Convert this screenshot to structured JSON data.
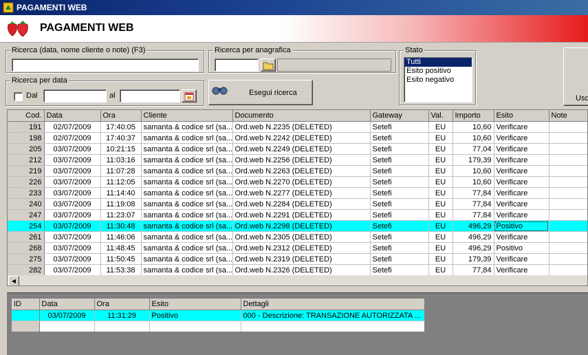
{
  "window": {
    "title": "PAGAMENTI WEB"
  },
  "banner": {
    "title": "PAGAMENTI WEB"
  },
  "search": {
    "text_label": "Ricerca (data, nome cliente o note) (F3)",
    "text_value": "",
    "anagrafica_label": "Ricerca per anagrafica",
    "anagrafica_code": "",
    "anagrafica_name": "",
    "date_label": "Ricerca per data",
    "dal_label": "Dal",
    "dal_value": "",
    "al_label": "al",
    "al_value": "",
    "run_button": "Esegui ricerca"
  },
  "stato": {
    "label": "Stato",
    "options": [
      "Tutti",
      "Esito positivo",
      "Esito negativo"
    ],
    "selected": "Tutti"
  },
  "exit_button": "Usc",
  "payments": {
    "columns": [
      "Cod.",
      "Data",
      "Ora",
      "Cliente",
      "Documento",
      "Gateway",
      "Val.",
      "Importo",
      "Esito",
      "Note"
    ],
    "rows": [
      {
        "cod": "191",
        "data": "02/07/2009",
        "ora": "17:40:05",
        "cliente": "samanta & codice srl (sa...",
        "documento": "Ord.web N.2235 (DELETED)",
        "gateway": "Setefi",
        "val": "EU",
        "importo": "10,60",
        "esito": "Verificare",
        "note": ""
      },
      {
        "cod": "198",
        "data": "02/07/2009",
        "ora": "17:40:37",
        "cliente": "samanta & codice srl (sa...",
        "documento": "Ord.web N.2242 (DELETED)",
        "gateway": "Setefi",
        "val": "EU",
        "importo": "10,60",
        "esito": "Verificare",
        "note": ""
      },
      {
        "cod": "205",
        "data": "03/07/2009",
        "ora": "10:21:15",
        "cliente": "samanta & codice srl (sa...",
        "documento": "Ord.web N.2249 (DELETED)",
        "gateway": "Setefi",
        "val": "EU",
        "importo": "77,04",
        "esito": "Verificare",
        "note": ""
      },
      {
        "cod": "212",
        "data": "03/07/2009",
        "ora": "11:03:16",
        "cliente": "samanta & codice srl (sa...",
        "documento": "Ord.web N.2256 (DELETED)",
        "gateway": "Setefi",
        "val": "EU",
        "importo": "179,39",
        "esito": "Verificare",
        "note": ""
      },
      {
        "cod": "219",
        "data": "03/07/2009",
        "ora": "11:07:28",
        "cliente": "samanta & codice srl (sa...",
        "documento": "Ord.web N.2263 (DELETED)",
        "gateway": "Setefi",
        "val": "EU",
        "importo": "10,60",
        "esito": "Verificare",
        "note": ""
      },
      {
        "cod": "226",
        "data": "03/07/2009",
        "ora": "11:12:05",
        "cliente": "samanta & codice srl (sa...",
        "documento": "Ord.web N.2270 (DELETED)",
        "gateway": "Setefi",
        "val": "EU",
        "importo": "10,60",
        "esito": "Verificare",
        "note": ""
      },
      {
        "cod": "233",
        "data": "03/07/2009",
        "ora": "11:14:40",
        "cliente": "samanta & codice srl (sa...",
        "documento": "Ord.web N.2277 (DELETED)",
        "gateway": "Setefi",
        "val": "EU",
        "importo": "77,84",
        "esito": "Verificare",
        "note": ""
      },
      {
        "cod": "240",
        "data": "03/07/2009",
        "ora": "11:19:08",
        "cliente": "samanta & codice srl (sa...",
        "documento": "Ord.web N.2284 (DELETED)",
        "gateway": "Setefi",
        "val": "EU",
        "importo": "77,84",
        "esito": "Verificare",
        "note": ""
      },
      {
        "cod": "247",
        "data": "03/07/2009",
        "ora": "11:23:07",
        "cliente": "samanta & codice srl (sa...",
        "documento": "Ord.web N.2291 (DELETED)",
        "gateway": "Setefi",
        "val": "EU",
        "importo": "77,84",
        "esito": "Verificare",
        "note": ""
      },
      {
        "cod": "254",
        "data": "03/07/2009",
        "ora": "11:30:48",
        "cliente": "samanta & codice srl (sa...",
        "documento": "Ord.web N.2298 (DELETED)",
        "gateway": "Setefi",
        "val": "EU",
        "importo": "496,29",
        "esito": "Positivo",
        "note": "",
        "selected": true
      },
      {
        "cod": "261",
        "data": "03/07/2009",
        "ora": "11:46:06",
        "cliente": "samanta & codice srl (sa...",
        "documento": "Ord.web N.2305 (DELETED)",
        "gateway": "Setefi",
        "val": "EU",
        "importo": "496,29",
        "esito": "Verificare",
        "note": ""
      },
      {
        "cod": "268",
        "data": "03/07/2009",
        "ora": "11:48:45",
        "cliente": "samanta & codice srl (sa...",
        "documento": "Ord.web N.2312 (DELETED)",
        "gateway": "Setefi",
        "val": "EU",
        "importo": "496,29",
        "esito": "Positivo",
        "note": ""
      },
      {
        "cod": "275",
        "data": "03/07/2009",
        "ora": "11:50:45",
        "cliente": "samanta & codice srl (sa...",
        "documento": "Ord.web N.2319 (DELETED)",
        "gateway": "Setefi",
        "val": "EU",
        "importo": "179,39",
        "esito": "Verificare",
        "note": ""
      },
      {
        "cod": "282",
        "data": "03/07/2009",
        "ora": "11:53:38",
        "cliente": "samanta & codice srl (sa...",
        "documento": "Ord.web N.2326 (DELETED)",
        "gateway": "Setefi",
        "val": "EU",
        "importo": "77,84",
        "esito": "Verificare",
        "note": ""
      }
    ]
  },
  "details": {
    "columns": [
      "ID",
      "Data",
      "Ora",
      "Esito",
      "Dettagli"
    ],
    "rows": [
      {
        "id": "",
        "data": "03/07/2009",
        "ora": "11:31:29",
        "esito": "Positivo",
        "dettagli": "000 - Descrizione: TRANSAZIONE AUTORIZZATA ...",
        "selected": true
      },
      {
        "id": "",
        "data": "",
        "ora": "",
        "esito": "",
        "dettagli": ""
      }
    ]
  },
  "colors": {
    "selection": "#00ffff",
    "face": "#d4d0c8",
    "titlebar": "#0a246a",
    "banner_red": "#e61b1b"
  }
}
